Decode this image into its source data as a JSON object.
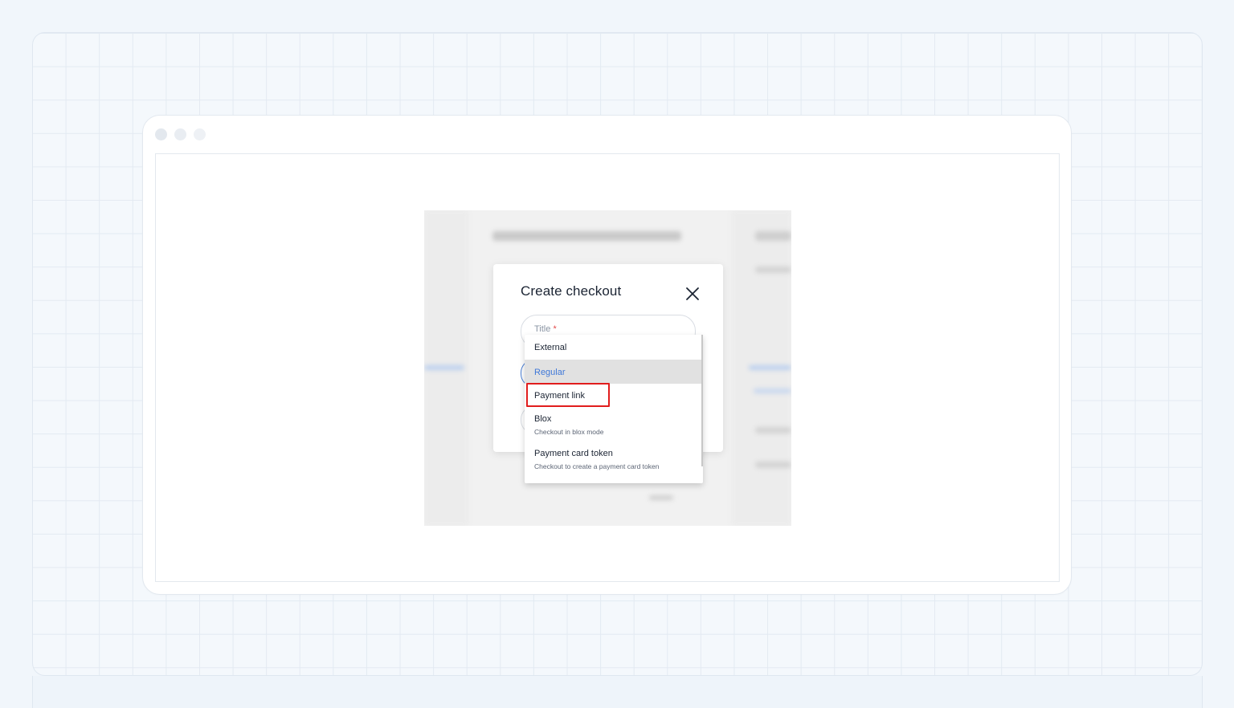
{
  "browser": {
    "window_dots": [
      "#e3e8ee",
      "#e9edf2",
      "#eef1f5"
    ]
  },
  "modal": {
    "title": "Create checkout",
    "close_icon": "close-icon",
    "title_field": {
      "label": "Title",
      "required_mark": "*"
    }
  },
  "dropdown": {
    "selected_index": 1,
    "highlighted_index": 2,
    "highlight_color": "#e11d1d",
    "selected_color": "#3f78d8",
    "items": [
      {
        "label": "External",
        "description": ""
      },
      {
        "label": "Regular",
        "description": ""
      },
      {
        "label": "Payment link",
        "description": ""
      },
      {
        "label": "Blox",
        "description": "Checkout in blox mode"
      },
      {
        "label": "Payment card token",
        "description": "Checkout to create a payment card token"
      }
    ]
  }
}
